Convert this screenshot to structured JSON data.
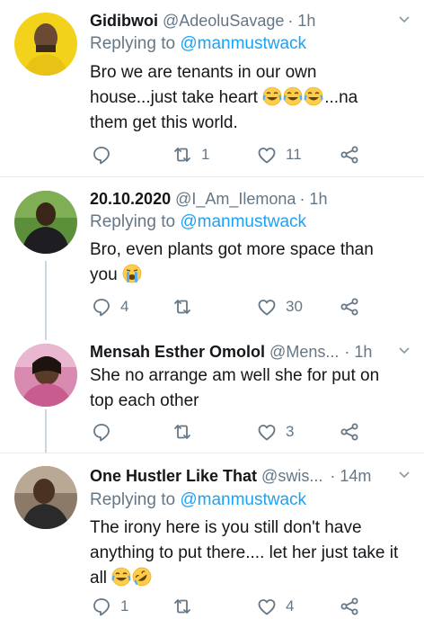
{
  "tweets": [
    {
      "name": "Gidibwoi",
      "handle": "@AdeoluSavage",
      "time": "· 1h",
      "replying_prefix": "Replying to ",
      "replying_mention": "@manmustwack",
      "text_line1": "Bro we are tenants in our own",
      "text_line2a": "house...just take heart ",
      "text_line2b": "...na",
      "text_line3": "them get this world.",
      "emojis": [
        "joy-emoji",
        "joy-emoji",
        "joy-emoji"
      ],
      "replies": "",
      "retweets": "1",
      "likes": "11",
      "avatar_color": "#f2d21b"
    },
    {
      "name": "20.10.2020",
      "handle": "@I_Am_Ilemona",
      "time": "· 1h",
      "replying_prefix": "Replying to ",
      "replying_mention": "@manmustwack",
      "text_line1": "Bro, even plants got more space than",
      "text_line2a": "you ",
      "emojis": [
        "sob-emoji"
      ],
      "replies": "4",
      "retweets": "",
      "likes": "30",
      "avatar_color": "#5b8f3a"
    },
    {
      "name": "Mensah Esther Omolol",
      "handle": "@Mens...",
      "time": "· 1h",
      "text_line1": "She no arrange am well she for put on",
      "text_line2a": "top each other",
      "replies": "",
      "retweets": "",
      "likes": "3",
      "avatar_color": "#c85c8e"
    },
    {
      "name": "One Hustler Like That",
      "handle": "@swis...",
      "time": "· 14m",
      "replying_prefix": "Replying to ",
      "replying_mention": "@manmustwack",
      "text_line1": "The irony here is you still don't have",
      "text_line2a": "anything to put there.... let her just take it",
      "text_line3": "all ",
      "emojis": [
        "joy-emoji",
        "rofl-emoji"
      ],
      "replies": "1",
      "retweets": "",
      "likes": "4",
      "avatar_color": "#6b5a4a"
    }
  ],
  "colors": {
    "accent": "#1da1f2",
    "secondary_text": "#657786",
    "primary_text": "#14171a",
    "divider": "#e6ecf0"
  }
}
